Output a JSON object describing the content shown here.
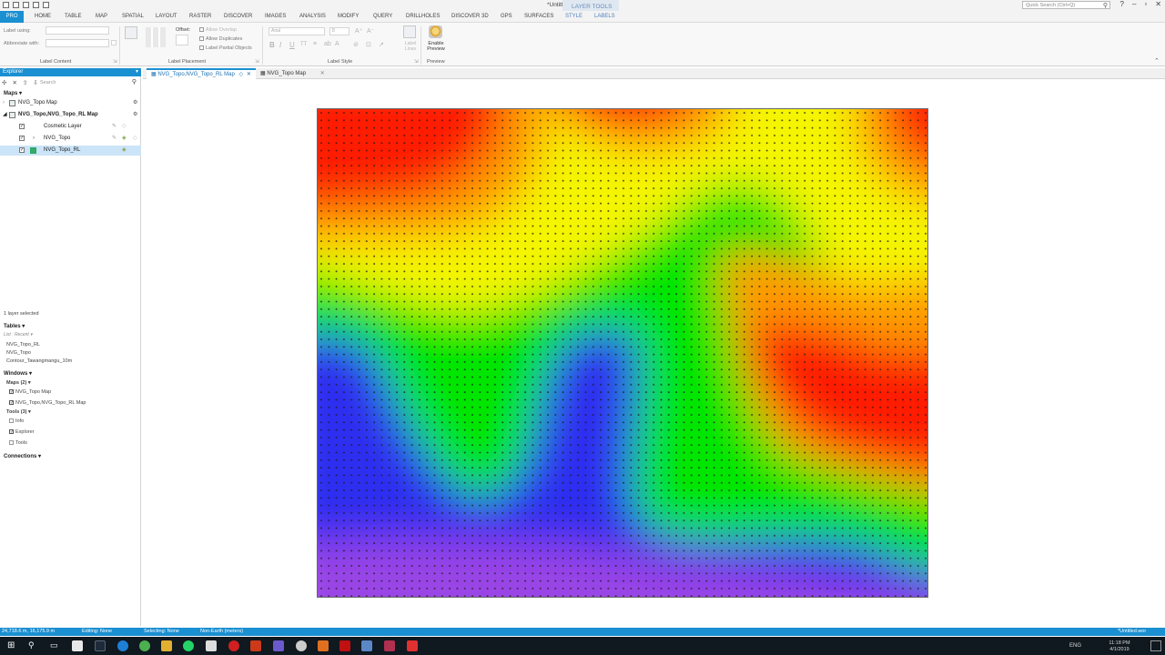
{
  "window": {
    "title": "*Untitled.wor - MapInfo Pro",
    "quick_search_placeholder": "Quick Search (Ctrl+Q)"
  },
  "ribbon": {
    "context_header": "LAYER TOOLS",
    "tabs": [
      "PRO",
      "HOME",
      "TABLE",
      "MAP",
      "SPATIAL",
      "LAYOUT",
      "RASTER",
      "DISCOVER",
      "IMAGES",
      "ANALYSIS",
      "MODIFY",
      "QUERY",
      "DRILLHOLES",
      "DISCOVER 3D",
      "GPS",
      "SURFACES",
      "STYLE",
      "LABELS"
    ],
    "active_tab": "LABELS",
    "label_content": {
      "group_label": "Label Content",
      "label_using": "Label using:",
      "abbreviate_with": "Abbreviate with:"
    },
    "label_placement": {
      "group_label": "Label Placement",
      "offset": "Offset:",
      "allow_overlap": "Allow Overlap",
      "allow_duplicates": "Allow Duplicates",
      "label_partial_objects": "Label Partial Objects"
    },
    "label_style": {
      "group_label": "Label Style",
      "font": "Arial",
      "size": "8"
    },
    "preview": {
      "group_label": "Preview",
      "enable_preview": "Enable Preview",
      "label_lines": "Label Lines"
    }
  },
  "explorer": {
    "title": "Explorer",
    "search_placeholder": "Search",
    "maps_header": "Maps",
    "maps": [
      {
        "name": "NVG_Topo Map"
      },
      {
        "name": "NVG_Topo,NVG_Topo_RL Map"
      }
    ],
    "layers": [
      {
        "name": "Cosmetic Layer"
      },
      {
        "name": "NVG_Topo"
      },
      {
        "name": "NVG_Topo_RL"
      }
    ],
    "selection_status": "1 layer selected",
    "tables_header": "Tables",
    "tables_list_mode": "List : Recent",
    "tables": [
      "NVG_Topo_RL",
      "NVG_Topo",
      "Contour_Tawangmangu_10m"
    ],
    "windows_header": "Windows",
    "maps_group": "Maps (2)",
    "window_maps": [
      "NVG_Topo Map",
      "NVG_Topo,NVG_Topo_RL Map"
    ],
    "tools_group": "Tools (3)",
    "tools": [
      {
        "name": "Info",
        "checked": false
      },
      {
        "name": "Explorer",
        "checked": true
      },
      {
        "name": "Tools",
        "checked": false
      }
    ],
    "connections_header": "Connections"
  },
  "doc_tabs": [
    {
      "label": "NVG_Topo,NVG_Topo_RL Map",
      "active": true
    },
    {
      "label": "NVG_Topo Map",
      "active": false
    }
  ],
  "statusbar": {
    "coords": "24,718.6 m, 16,175.9 m",
    "editing": "Editing: None",
    "selecting": "Selecting: None",
    "projection": "Non-Earth (meters)",
    "workspace": "*Untitled.wor"
  },
  "taskbar": {
    "language": "ENG",
    "time": "11:18 PM",
    "date": "4/1/2019"
  },
  "colors": {
    "accent": "#1a8fd1",
    "selection": "#cce4f7",
    "surface_ramp": [
      "#9a44e6",
      "#2d2ff0",
      "#00e600",
      "#f5f500",
      "#ff9a00",
      "#ff1a00"
    ]
  }
}
